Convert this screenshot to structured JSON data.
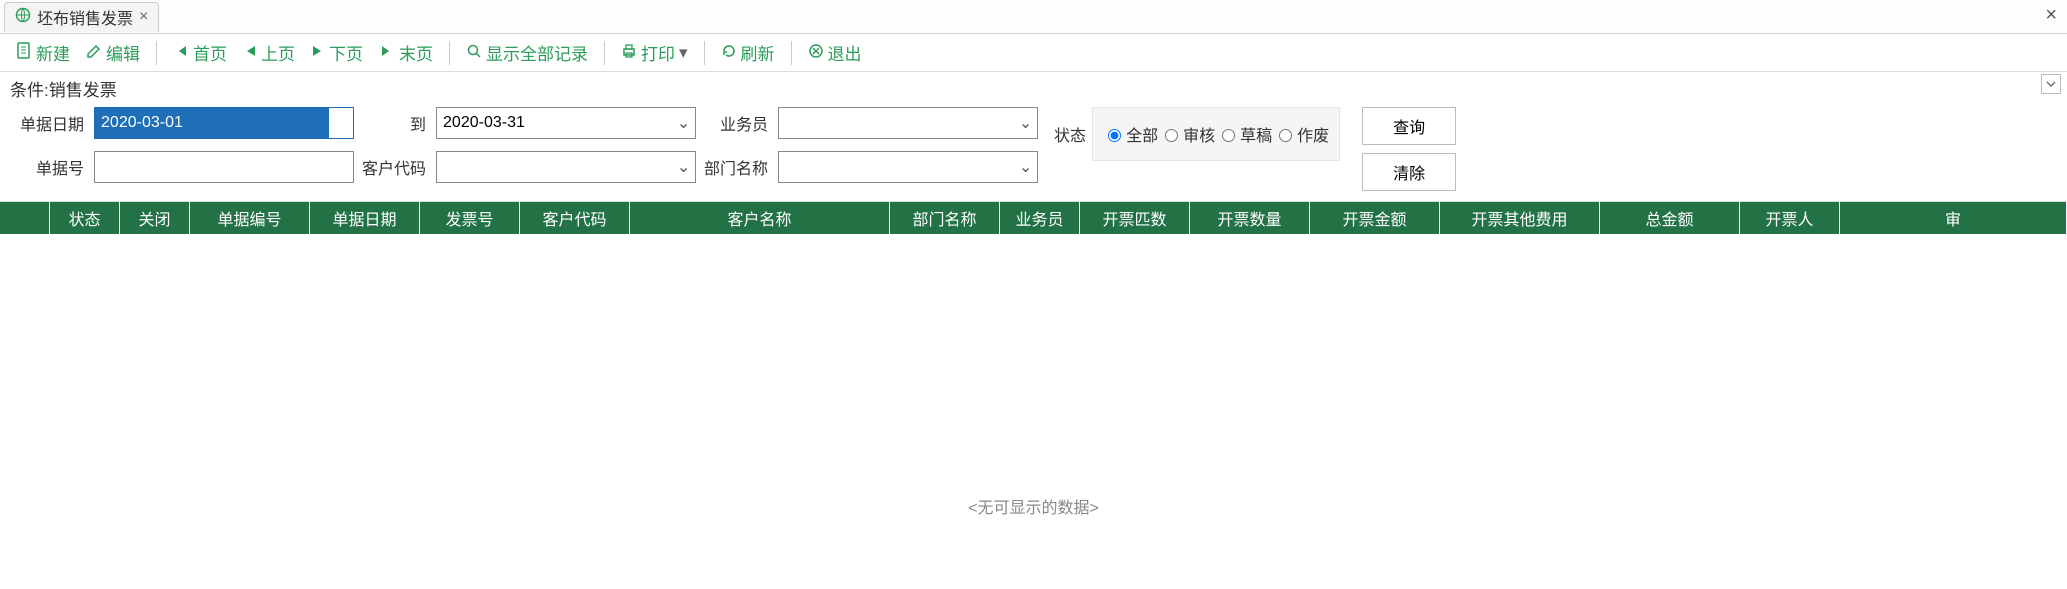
{
  "tab": {
    "title": "坯布销售发票"
  },
  "toolbar": {
    "new": "新建",
    "edit": "编辑",
    "first": "首页",
    "prev": "上页",
    "next": "下页",
    "last": "末页",
    "show_all": "显示全部记录",
    "print": "打印",
    "refresh": "刷新",
    "exit": "退出"
  },
  "cond": {
    "label": "条件:销售发票"
  },
  "filter": {
    "bill_date_label": "单据日期",
    "bill_date_from": "2020-03-01",
    "to": "到",
    "bill_date_to": "2020-03-31",
    "salesman_label": "业务员",
    "salesman": "",
    "bill_no_label": "单据号",
    "bill_no": "",
    "cust_code_label": "客户代码",
    "cust_code": "",
    "dept_label": "部门名称",
    "dept": "",
    "status_label": "状态",
    "status_options": {
      "all": "全部",
      "audited": "审核",
      "draft": "草稿",
      "void": "作废"
    },
    "status_selected": "all",
    "query": "查询",
    "clear": "清除"
  },
  "table": {
    "columns": [
      "",
      "状态",
      "关闭",
      "单据编号",
      "单据日期",
      "发票号",
      "客户代码",
      "客户名称",
      "部门名称",
      "业务员",
      "开票匹数",
      "开票数量",
      "开票金额",
      "开票其他费用",
      "总金额",
      "开票人",
      "审"
    ],
    "empty_text": "<无可显示的数据>"
  }
}
